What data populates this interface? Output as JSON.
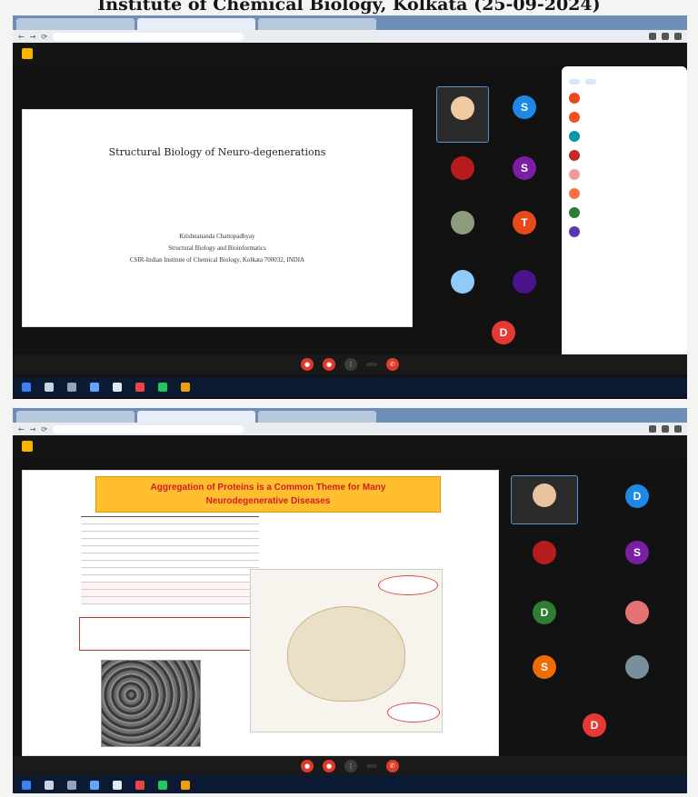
{
  "doc_title": "Institute of Chemical Biology, Kolkata (25-09-2024)",
  "screenshot1": {
    "slide": {
      "title": "Structural Biology of Neuro-degenerations",
      "speaker": "Krishnananda Chattopadhyay",
      "department": "Structural Biology and Bioinformatics",
      "institute": "CSIR-Indian Institute of Chemical Biology, Kolkata 700032, INDIA"
    },
    "tiles": [
      {
        "initial": "",
        "color": "#f1c9a0"
      },
      {
        "initial": "S",
        "color": "#1e88e5"
      },
      {
        "initial": "",
        "color": "#b71c1c"
      },
      {
        "initial": "S",
        "color": "#7b1fa2"
      },
      {
        "initial": "",
        "color": "#8d9c7a"
      },
      {
        "initial": "T",
        "color": "#e64a19"
      },
      {
        "initial": "",
        "color": "#90caf9"
      },
      {
        "initial": "",
        "color": "#4a148c"
      },
      {
        "initial": "D",
        "color": "#e53935"
      }
    ],
    "participants": [
      {
        "color": "#e64a19"
      },
      {
        "color": "#f4511e"
      },
      {
        "color": "#0097a7"
      },
      {
        "color": "#c62828"
      },
      {
        "color": "#ef9a9a"
      },
      {
        "color": "#ff7043"
      },
      {
        "color": "#2e7d32"
      },
      {
        "color": "#5e35b1"
      }
    ]
  },
  "screenshot2": {
    "slide": {
      "banner_line1": "Aggregation of Proteins is a Common Theme for Many",
      "banner_line2": "Neurodegenerative Diseases"
    },
    "tiles": [
      {
        "initial": "",
        "color": "#e8c39e"
      },
      {
        "initial": "D",
        "color": "#1e88e5"
      },
      {
        "initial": "",
        "color": "#b71c1c"
      },
      {
        "initial": "S",
        "color": "#7b1fa2"
      },
      {
        "initial": "D",
        "color": "#2e7d32"
      },
      {
        "initial": "",
        "color": "#e57373"
      },
      {
        "initial": "S",
        "color": "#ef6c00"
      },
      {
        "initial": "",
        "color": "#78909c"
      },
      {
        "initial": "D",
        "color": "#e53935"
      }
    ]
  },
  "colors": {
    "slide_banner": "#ffbf2e",
    "banner_text": "#d11e1e",
    "end_call": "#e23a2a",
    "meet_bg": "#121212",
    "panel_bg": "#ffffff"
  },
  "icons": [
    "meet-logo-icon",
    "mic-off-icon",
    "camera-off-icon",
    "end-call-icon",
    "chevron-icon"
  ]
}
